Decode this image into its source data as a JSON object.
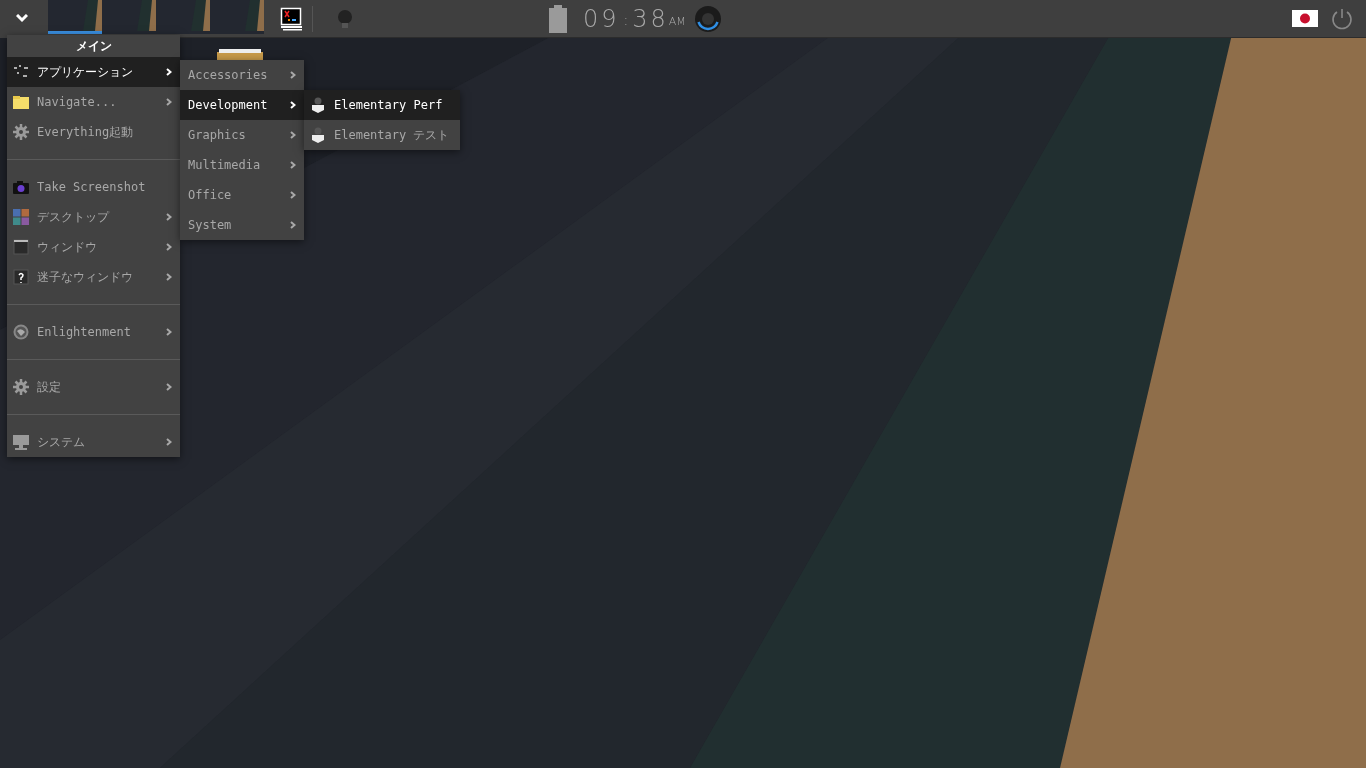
{
  "shelf": {
    "desks": [
      {
        "selected": true
      },
      {
        "selected": false
      },
      {
        "selected": false
      },
      {
        "selected": false
      }
    ],
    "clock": {
      "hours": "09",
      "separator": ":",
      "minutes": "38",
      "meridiem": "AM"
    }
  },
  "main_menu": {
    "title": "メイン",
    "items": [
      {
        "kind": "item",
        "label": "アプリケーション",
        "submenu": true,
        "selected": true
      },
      {
        "kind": "item",
        "label": "Navigate...",
        "submenu": true,
        "selected": false
      },
      {
        "kind": "item",
        "label": "Everything起動",
        "submenu": false,
        "selected": false
      },
      {
        "kind": "separator"
      },
      {
        "kind": "item",
        "label": "Take Screenshot",
        "submenu": false,
        "selected": false
      },
      {
        "kind": "item",
        "label": "デスクトップ",
        "submenu": true,
        "selected": false
      },
      {
        "kind": "item",
        "label": "ウィンドウ",
        "submenu": true,
        "selected": false
      },
      {
        "kind": "item",
        "label": "迷子なウィンドウ",
        "submenu": true,
        "selected": false
      },
      {
        "kind": "separator"
      },
      {
        "kind": "item",
        "label": "Enlightenment",
        "submenu": true,
        "selected": false
      },
      {
        "kind": "separator"
      },
      {
        "kind": "item",
        "label": "設定",
        "submenu": true,
        "selected": false
      },
      {
        "kind": "separator"
      },
      {
        "kind": "item",
        "label": "システム",
        "submenu": true,
        "selected": false
      }
    ]
  },
  "applications_menu": {
    "items": [
      {
        "label": "Accessories",
        "selected": false
      },
      {
        "label": "Development",
        "selected": true
      },
      {
        "label": "Graphics",
        "selected": false
      },
      {
        "label": "Multimedia",
        "selected": false
      },
      {
        "label": "Office",
        "selected": false
      },
      {
        "label": "System",
        "selected": false
      }
    ]
  },
  "development_menu": {
    "items": [
      {
        "label": "Elementary Perf",
        "selected": true
      },
      {
        "label": "Elementary テスト",
        "selected": false
      }
    ]
  }
}
